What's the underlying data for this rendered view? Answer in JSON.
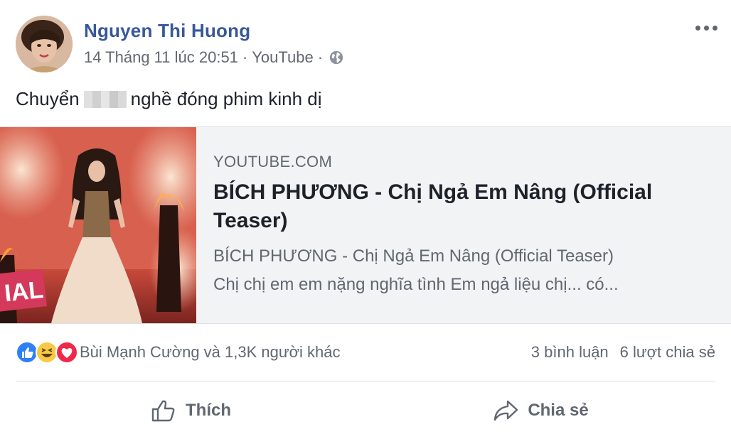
{
  "post": {
    "author": "Nguyen Thi Huong",
    "timestamp": "14 Tháng 11 lúc 20:51",
    "source": "YouTube",
    "separator1": "·",
    "separator2": "·",
    "text_before": "Chuyển",
    "text_after": "nghề đóng phim kinh dị",
    "privacy_icon": "globe-icon",
    "menu_icon": "more-options-icon"
  },
  "link": {
    "domain": "YOUTUBE.COM",
    "title": "BÍCH PHƯƠNG - Chị Ngả Em Nâng (Official Teaser)",
    "desc_line1": "BÍCH PHƯƠNG - Chị Ngả Em Nâng (Official Teaser)",
    "desc_line2": "Chị chị em em nặng nghĩa tình Em ngả liệu chị... có...",
    "thumb_overlay_text": "IAL"
  },
  "stats": {
    "reactions_text": "Bùi Mạnh Cường và 1,3K người khác",
    "comments": "3 bình luận",
    "shares": "6 lượt chia sẻ",
    "reaction_icons": [
      "like-icon",
      "haha-icon",
      "love-icon"
    ]
  },
  "actions": {
    "like_label": "Thích",
    "share_label": "Chia sẻ"
  },
  "colors": {
    "author_link": "#385898",
    "secondary_text": "#606770",
    "card_bg": "#f2f3f5",
    "like_blue": "#2e80f6",
    "love_red": "#f0284a",
    "haha_yellow": "#f7c944"
  }
}
